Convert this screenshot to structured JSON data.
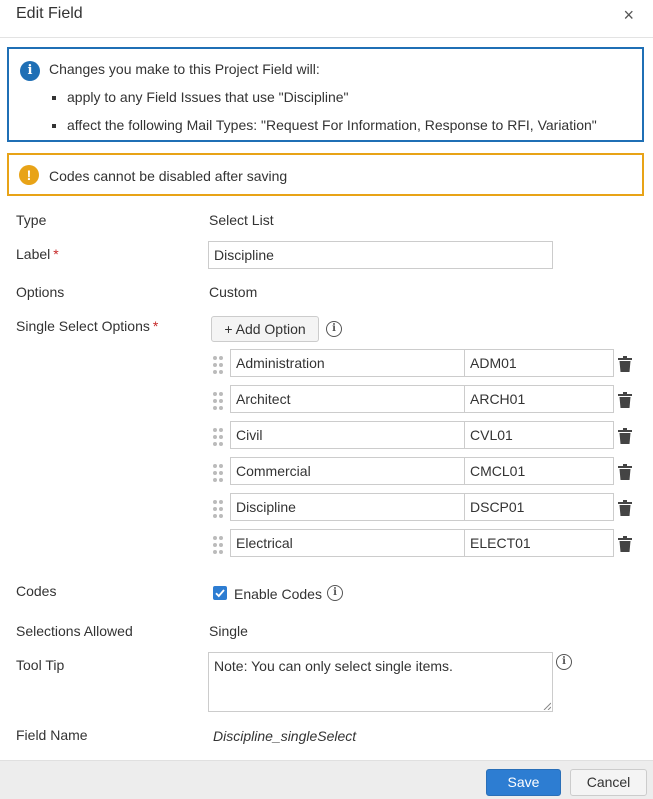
{
  "dialog": {
    "title": "Edit Field",
    "close": "×"
  },
  "info": {
    "icon": "info-icon",
    "text": "Changes you make to this Project Field will:",
    "bullets": [
      "apply to any Field Issues that use \"Discipline\"",
      "affect the following Mail Types: \"Request For Information, Response to RFI, Variation\""
    ]
  },
  "warning": {
    "icon": "warning-icon",
    "text": "Codes cannot be disabled after saving"
  },
  "fields": {
    "type": {
      "label": "Type",
      "value": "Select List"
    },
    "label": {
      "label": "Label",
      "required": "*",
      "value": "Discipline"
    },
    "options": {
      "label": "Options",
      "value": "Custom"
    },
    "single_select": {
      "label": "Single Select Options",
      "required": "*",
      "add_button": "+ Add Option"
    },
    "codes": {
      "label": "Codes",
      "checkbox_label": "Enable Codes",
      "checked": true
    },
    "selections": {
      "label": "Selections Allowed",
      "value": "Single"
    },
    "tooltip": {
      "label": "Tool Tip",
      "value": "Note: You can only select single items."
    },
    "field_name": {
      "label": "Field Name",
      "value": "Discipline_singleSelect"
    }
  },
  "option_rows": [
    {
      "name": "Administration",
      "code": "ADM01"
    },
    {
      "name": "Architect",
      "code": "ARCH01"
    },
    {
      "name": "Civil",
      "code": "CVL01"
    },
    {
      "name": "Commercial",
      "code": "CMCL01"
    },
    {
      "name": "Discipline",
      "code": "DSCP01"
    },
    {
      "name": "Electrical",
      "code": "ELECT01"
    }
  ],
  "footer": {
    "save": "Save",
    "cancel": "Cancel"
  },
  "colors": {
    "primary": "#2d7dd2",
    "info_border": "#1f6fb5",
    "warning": "#e8a317",
    "required": "#c62828"
  }
}
